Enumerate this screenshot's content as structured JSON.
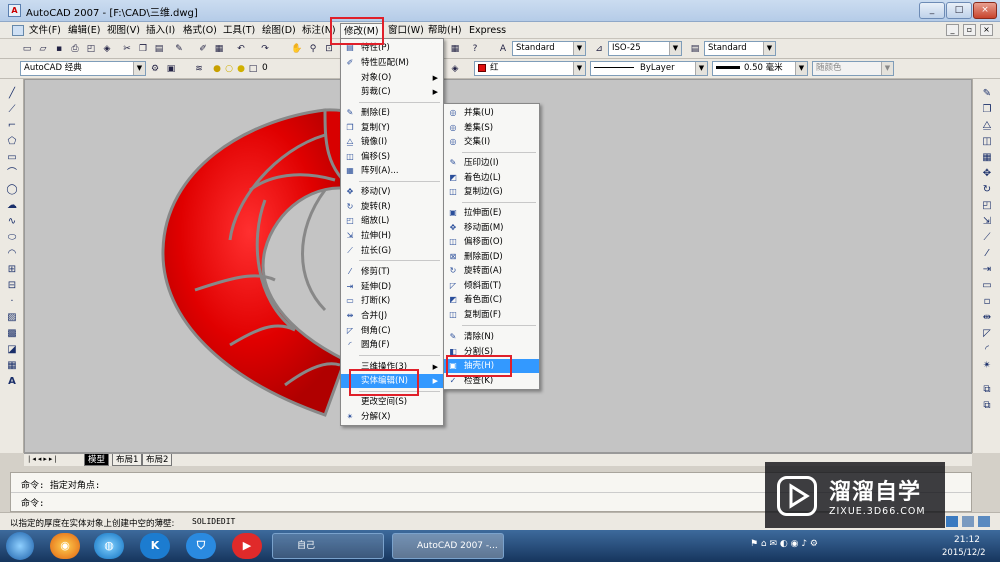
{
  "window": {
    "title": "AutoCAD 2007 - [F:\\CAD\\三维.dwg]",
    "app_icon": "autocad-icon",
    "buttons": [
      "_",
      "□",
      "×"
    ]
  },
  "menubar": {
    "items": [
      "文件(F)",
      "编辑(E)",
      "视图(V)",
      "插入(I)",
      "格式(O)",
      "工具(T)",
      "绘图(D)",
      "标注(N)",
      "修改(M)",
      "窗口(W)",
      "帮助(H)",
      "Express"
    ],
    "mdi_buttons": [
      "_",
      "▫",
      "×"
    ]
  },
  "toolbar1": {
    "text_style": "Standard",
    "dim_style": "ISO-25",
    "table_style": "Standard"
  },
  "toolbar2": {
    "workspace": "AutoCAD 经典",
    "layer": "0",
    "color": "红",
    "color_hex": "#e01010",
    "linetype": "ByLayer",
    "lineweight": "0.50 毫米",
    "plotstyle": "随颜色"
  },
  "modify_menu": {
    "title": "修改(M)",
    "items": [
      {
        "label": "特性(P)",
        "icon": "properties-icon"
      },
      {
        "label": "特性匹配(M)",
        "icon": "match-properties-icon"
      },
      {
        "label": "对象(O)",
        "submenu": true
      },
      {
        "label": "剪裁(C)",
        "submenu": true
      },
      {
        "label": "删除(E)",
        "icon": "erase-icon"
      },
      {
        "label": "复制(Y)",
        "icon": "copy-icon"
      },
      {
        "label": "镜像(I)",
        "icon": "mirror-icon"
      },
      {
        "label": "偏移(S)",
        "icon": "offset-icon"
      },
      {
        "label": "阵列(A)...",
        "icon": "array-icon"
      },
      {
        "label": "移动(V)",
        "icon": "move-icon"
      },
      {
        "label": "旋转(R)",
        "icon": "rotate-icon"
      },
      {
        "label": "缩放(L)",
        "icon": "scale-icon"
      },
      {
        "label": "拉伸(H)",
        "icon": "stretch-icon"
      },
      {
        "label": "拉长(G)",
        "icon": "lengthen-icon"
      },
      {
        "label": "修剪(T)",
        "icon": "trim-icon"
      },
      {
        "label": "延伸(D)",
        "icon": "extend-icon"
      },
      {
        "label": "打断(K)",
        "icon": "break-icon"
      },
      {
        "label": "合并(J)",
        "icon": "join-icon"
      },
      {
        "label": "倒角(C)",
        "icon": "chamfer-icon"
      },
      {
        "label": "圆角(F)",
        "icon": "fillet-icon"
      },
      {
        "label": "三维操作(3)",
        "submenu": true
      },
      {
        "label": "实体编辑(N)",
        "submenu": true,
        "highlighted": true
      },
      {
        "label": "更改空间(S)"
      },
      {
        "label": "分解(X)",
        "icon": "explode-icon"
      }
    ]
  },
  "solid_edit_menu": {
    "items": [
      {
        "label": "并集(U)",
        "icon": "union-icon"
      },
      {
        "label": "差集(S)",
        "icon": "subtract-icon"
      },
      {
        "label": "交集(I)",
        "icon": "intersect-icon"
      },
      {
        "label": "压印边(I)",
        "icon": "imprint-icon"
      },
      {
        "label": "着色边(L)",
        "icon": "color-edges-icon"
      },
      {
        "label": "复制边(G)",
        "icon": "copy-edges-icon"
      },
      {
        "label": "拉伸面(E)",
        "icon": "extrude-faces-icon"
      },
      {
        "label": "移动面(M)",
        "icon": "move-faces-icon"
      },
      {
        "label": "偏移面(O)",
        "icon": "offset-faces-icon"
      },
      {
        "label": "删除面(D)",
        "icon": "delete-faces-icon"
      },
      {
        "label": "旋转面(A)",
        "icon": "rotate-faces-icon"
      },
      {
        "label": "倾斜面(T)",
        "icon": "taper-faces-icon"
      },
      {
        "label": "着色面(C)",
        "icon": "color-faces-icon"
      },
      {
        "label": "复制面(F)",
        "icon": "copy-faces-icon"
      },
      {
        "label": "清除(N)",
        "icon": "clean-icon"
      },
      {
        "label": "分割(S)",
        "icon": "separate-icon"
      },
      {
        "label": "抽壳(H)",
        "icon": "shell-icon",
        "highlighted": true
      },
      {
        "label": "检查(K)",
        "icon": "check-icon"
      }
    ]
  },
  "layout_tabs": [
    "模型",
    "布局1",
    "布局2"
  ],
  "command": {
    "line1": "命令: 指定对角点:",
    "line2": "命令:"
  },
  "status": {
    "text": "以指定的厚度在实体对象上创建中空的薄壁:",
    "command": "SOLIDEDIT"
  },
  "taskbar": {
    "tasks": [
      "自己",
      "AutoCAD 2007 -..."
    ],
    "time": "21:12",
    "date": "2015/12/2"
  },
  "watermark": {
    "cn": "溜溜自学",
    "en": "ZIXUE.3D66.COM"
  }
}
